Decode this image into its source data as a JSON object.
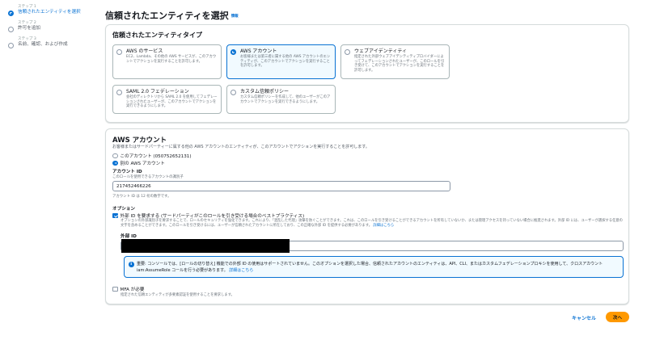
{
  "steps": [
    {
      "kicker": "ステップ 1",
      "name": "信頼されたエンティティを選択",
      "active": true
    },
    {
      "kicker": "ステップ 2",
      "name": "許可を追加",
      "active": false
    },
    {
      "kicker": "ステップ 3",
      "name": "名前、確認、および作成",
      "active": false
    }
  ],
  "header": {
    "title": "信頼されたエンティティを選択",
    "info": "情報"
  },
  "entity_type": {
    "title": "信頼されたエンティティタイプ",
    "options": [
      {
        "title": "AWS のサービス",
        "desc": "EC2、Lambda、その他の AWS サービスが、このアカウントでアクションを実行することを許可します。",
        "selected": false
      },
      {
        "title": "AWS アカウント",
        "desc": "お客様または第三者に属する他の AWS アカウントのエンティティが、このアカウントでアクションを実行することを許可します。",
        "selected": true
      },
      {
        "title": "ウェブアイデンティティ",
        "desc": "指定された外部ウェブアイデンティティプロバイダーによってフェデレーションされたユーザーが、このロールを引き受けて、このアカウントでアクションを実行することを許可します。",
        "selected": false
      },
      {
        "title": "SAML 2.0 フェデレーション",
        "desc": "会社のディレクトリから SAML 2.0 を使用してフェデレーションされたユーザーが、このアカウントでアクションを実行できるようにします。",
        "selected": false
      },
      {
        "title": "カスタム信頼ポリシー",
        "desc": "カスタム信頼ポリシーを作成して、他のユーザーがこのアカウントでアクションを実行できるようにします。",
        "selected": false
      }
    ]
  },
  "aws_account": {
    "title": "AWS アカウント",
    "desc": "お客様またはサードパーティーに属する他の AWS アカウントのエンティティが、このアカウントでアクションを実行することを許可します。",
    "this_account": "このアカウント (050752652131)",
    "other_account": "別の AWS アカウント",
    "account_id_label": "アカウント ID",
    "account_id_desc": "このロールを使用できるアカウントの識別子",
    "account_id_value": "217452466226",
    "account_id_hint": "アカウント ID は 12 桁の数字です。",
    "options_label": "オプション",
    "external_id_checkbox": "外部 ID を要求する (サードパーティがこのロールを引き受ける場合のベストプラクティス)",
    "external_id_desc": "オプションの外部識別子を要求することで、ロールのセキュリティを強化できます。これにより、「混乱した代理」攻撃を防ぐことができます。これは、このロールを引き受けることができるアカウントを所有していないか、または管理アクセスを持っていない場合に推奨されます。外部 ID には、ユーザーが選択する任意の文字を含めることができます。このロールを引き受けるには、ユーザーが信頼されたアカウントに所在しており、この正確な外部 ID を提供する必要があります。",
    "external_id_link": "詳細はこちら",
    "external_id_label": "外部 ID",
    "info_text": "重要: コンソールでは、[ロールの切り替え] 機能での外部 ID の使用はサポートされていません。このオプションを選択した場合、信頼されたアカウントのエンティティは、API、CLI、またはカスタムフェデレーションプロキシを使用して、クロスアカウント iam:AssumeRole コールを行う必要があります。",
    "info_link": "詳細はこちら",
    "mfa_checkbox": "MFA が必要",
    "mfa_desc": "指定された信頼エンティティが多要素認証を使用することを要求します。"
  },
  "footer": {
    "cancel": "キャンセル",
    "next": "次へ"
  }
}
